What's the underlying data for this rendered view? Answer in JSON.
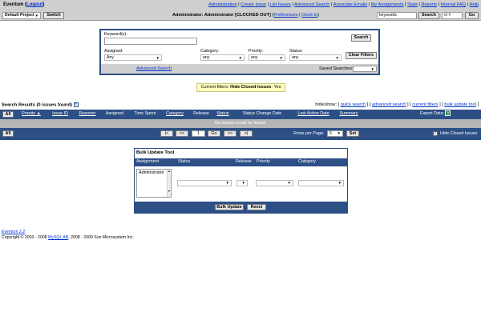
{
  "topbar": {
    "app_name": "Eventum",
    "logout": "Logout",
    "nav_links": [
      "Administration",
      "Create Issue",
      "List Issues",
      "Advanced Search",
      "Associate Emails",
      "My Assignments",
      "Stats",
      "Reports",
      "Internal FAQ",
      "Help"
    ],
    "project_select": "Default Project",
    "switch_label": "Switch",
    "user_status": "Administrator: Administrator [CLOCKED OUT]",
    "preferences": "Preferences",
    "clock_in": "Clock In",
    "keyword_value": "keywords",
    "search_button": "Search",
    "issue_id_placeholder": "id #",
    "go_button": "Go"
  },
  "search_form": {
    "keywords_label": "Keyword(s):",
    "search_button": "Search",
    "assigned_label": "Assigned:",
    "assigned_value": "Any",
    "category_label": "Category:",
    "category_value": "any",
    "priority_label": "Priority:",
    "priority_value": "any",
    "status_label": "Status:",
    "status_value": "any",
    "clear_filters": "Clear Filters",
    "advanced_search": "Advanced Search",
    "saved_searches_label": "Saved Searches:"
  },
  "filters": {
    "prefix": "Current filters:",
    "text": "Hide Closed Issues",
    "value": "Yes"
  },
  "results": {
    "title": "Search Results (0 issues found)",
    "hide_show_label": "hide/show:",
    "hide_show_links": [
      "quick search",
      "advanced search",
      "current filters",
      "bulk update tool"
    ],
    "all_button": "All",
    "columns": [
      "Priority",
      "Issue ID",
      "Reporter",
      "Assigned",
      "Time Spent",
      "Category",
      "Release",
      "Status",
      "Status Change Date",
      "Last Action Date",
      "Summary"
    ],
    "export_label": "Export Data:",
    "empty_message": "No issues could be found.",
    "pager": {
      "first": "|<",
      "prev": "<<",
      "page": "1",
      "go": "Go",
      "next": ">>",
      "last": ">|"
    },
    "rows_per_page_label": "Rows per Page:",
    "rows_per_page_value": "5",
    "set_button": "Set",
    "hide_closed_label": "Hide Closed Issues",
    "hide_closed_checked": true
  },
  "bulk_update": {
    "title": "Bulk Update Tool",
    "columns": [
      "Assignment",
      "Status",
      "Release",
      "Priority",
      "Category"
    ],
    "assignee_option": "Administrator",
    "bulk_update_button": "Bulk Update",
    "reset_button": "Reset"
  },
  "footer": {
    "version": "Eventum 2.2",
    "copyright_prefix": "Copyright © 2003 - 2008 ",
    "copyright_link": "MySQL AB",
    "copyright_suffix": ", 2008 - 2009 Sun Microsystem Inc."
  },
  "colors": {
    "nav_blue": "#2c4f86",
    "header_gray": "#cfcfcf",
    "row_gray": "#b5b5b5",
    "filter_yellow": "#ffffc0"
  }
}
